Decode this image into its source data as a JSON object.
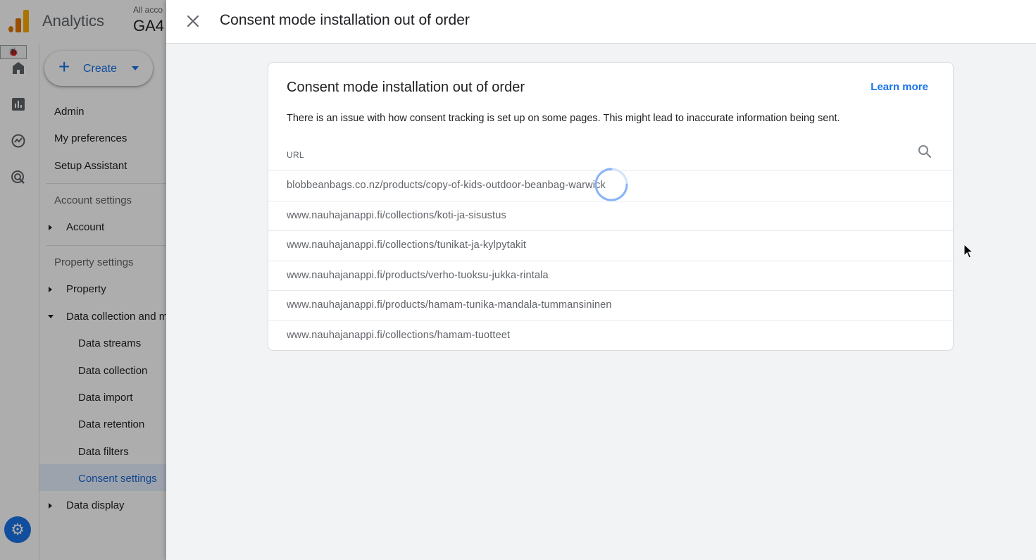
{
  "app": {
    "name": "Analytics",
    "account_label": "All acco",
    "property_label": "GA4"
  },
  "rail": {
    "bug_glyph": "🐞",
    "icons": [
      "home-icon",
      "reports-icon",
      "explore-icon",
      "advertising-icon"
    ],
    "settings_icon": "gear-icon"
  },
  "nav": {
    "create_label": "Create",
    "admin": "Admin",
    "my_preferences": "My preferences",
    "setup_assistant": "Setup Assistant",
    "account_settings": "Account settings",
    "account": "Account",
    "property_settings": "Property settings",
    "property": "Property",
    "data_collection_and": "Data collection and m",
    "data_streams": "Data streams",
    "data_collection": "Data collection",
    "data_import": "Data import",
    "data_retention": "Data retention",
    "data_filters": "Data filters",
    "consent_settings": "Consent settings",
    "data_display": "Data display"
  },
  "sheet": {
    "title": "Consent mode installation out of order",
    "close_icon": "close-icon"
  },
  "card": {
    "title": "Consent mode installation out of order",
    "learn_more": "Learn more",
    "description": "There is an issue with how consent tracking is set up on some pages. This might lead to inaccurate information being sent.",
    "column_header": "URL",
    "search_icon": "search-icon",
    "urls": [
      "blobbeanbags.co.nz/products/copy-of-kids-outdoor-beanbag-warwick",
      "www.nauhajanappi.fi/collections/koti-ja-sisustus",
      "www.nauhajanappi.fi/collections/tunikat-ja-kylpytakit",
      "www.nauhajanappi.fi/products/verho-tuoksu-jukka-rintala",
      "www.nauhajanappi.fi/products/hamam-tunika-mandala-tummansininen",
      "www.nauhajanappi.fi/collections/hamam-tuotteet"
    ]
  },
  "colors": {
    "accent": "#1a73e8",
    "spinner": "#1a73e8",
    "brand_orange": "#f9ab00"
  }
}
